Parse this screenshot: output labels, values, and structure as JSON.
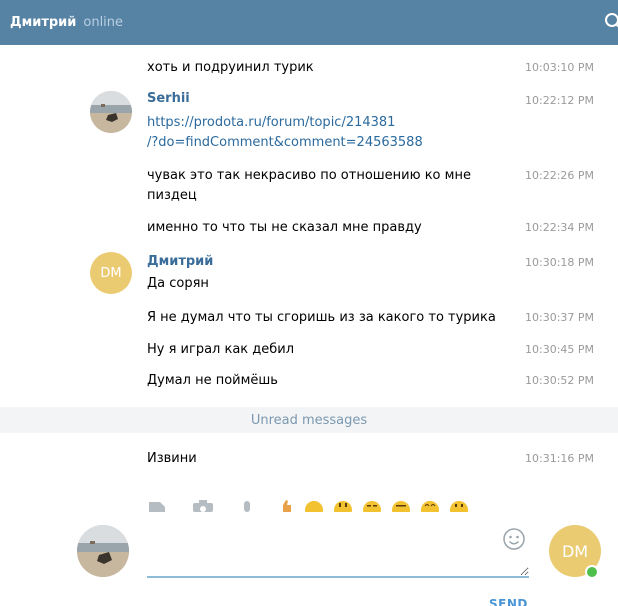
{
  "header": {
    "contact_name": "Дмитрий",
    "status": "online",
    "color": "#5682a3"
  },
  "messages": [
    {
      "text": "хоть и подруинил турик",
      "time": "10:03:10 PM"
    },
    {
      "author": "Serhii",
      "text_line1": "https://prodota.ru/forum/topic/214381",
      "text_line2": "/?do=findComment&comment=24563588",
      "time": "10:22:12 PM"
    },
    {
      "text": "чувак это так некрасиво по отношению ко мне пиздец",
      "time": "10:22:26 PM"
    },
    {
      "text": "именно то что ты не сказал мне правду",
      "time": "10:22:34 PM"
    },
    {
      "author": "Дмитрий",
      "avatar_initials": "DM",
      "text": "Да сорян",
      "time": "10:30:18 PM"
    },
    {
      "text": "Я не думал что ты сгоришь из за какого то турика",
      "time": "10:30:37 PM"
    },
    {
      "text": "Ну я играл как дебил",
      "time": "10:30:45 PM"
    },
    {
      "text": "Думал не поймёшь",
      "time": "10:30:52 PM"
    },
    {
      "text": "Извини",
      "time": "10:31:16 PM"
    }
  ],
  "unread_label": "Unread messages",
  "composer": {
    "value": "",
    "send_label": "SEND",
    "peer_initials": "DM",
    "toolbar_icons": [
      "document-icon",
      "camera-icon",
      "microphone-icon",
      "thumbs-up-icon",
      "emoji-icon"
    ]
  }
}
